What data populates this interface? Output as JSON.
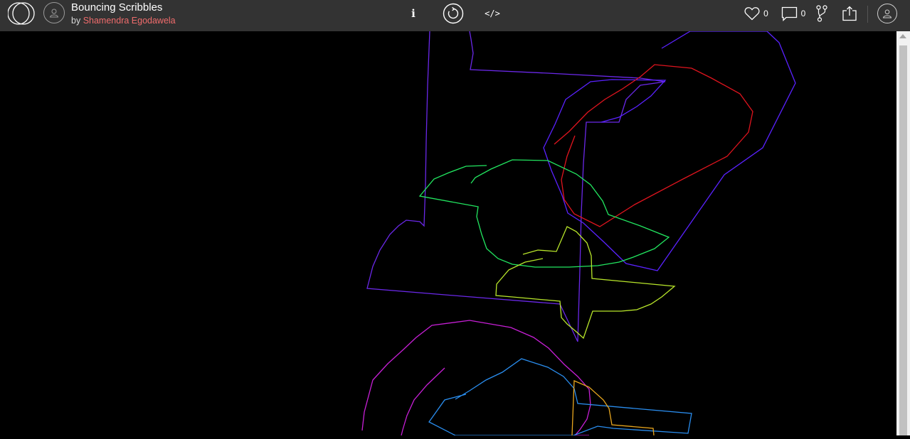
{
  "header": {
    "title": "Bouncing Scribbles",
    "by_prefix": "by",
    "author": "Shamendra Egodawela",
    "info_label": "i",
    "code_label": "</>",
    "likes": "0",
    "comments": "0",
    "author_color": "#f06c6c",
    "bar_color": "#333333"
  },
  "icons": {
    "logo": "overlapping-circles-logo",
    "avatar": "user-avatar-icon",
    "restart": "restart-icon",
    "heart": "heart-icon",
    "comment": "comment-icon",
    "fork": "fork-icon",
    "share": "share-icon",
    "user": "user-icon"
  },
  "canvas": {
    "background": "#000000",
    "scribbles": [
      {
        "color": "#6a28e8",
        "label": "violet"
      },
      {
        "color": "#5a22ff",
        "label": "indigo"
      },
      {
        "color": "#e0141e",
        "label": "red"
      },
      {
        "color": "#22e660",
        "label": "green"
      },
      {
        "color": "#b8e62a",
        "label": "lime"
      },
      {
        "color": "#c71fd6",
        "label": "magenta"
      },
      {
        "color": "#2a8ef0",
        "label": "blue"
      },
      {
        "color": "#e8a61e",
        "label": "orange"
      }
    ]
  }
}
